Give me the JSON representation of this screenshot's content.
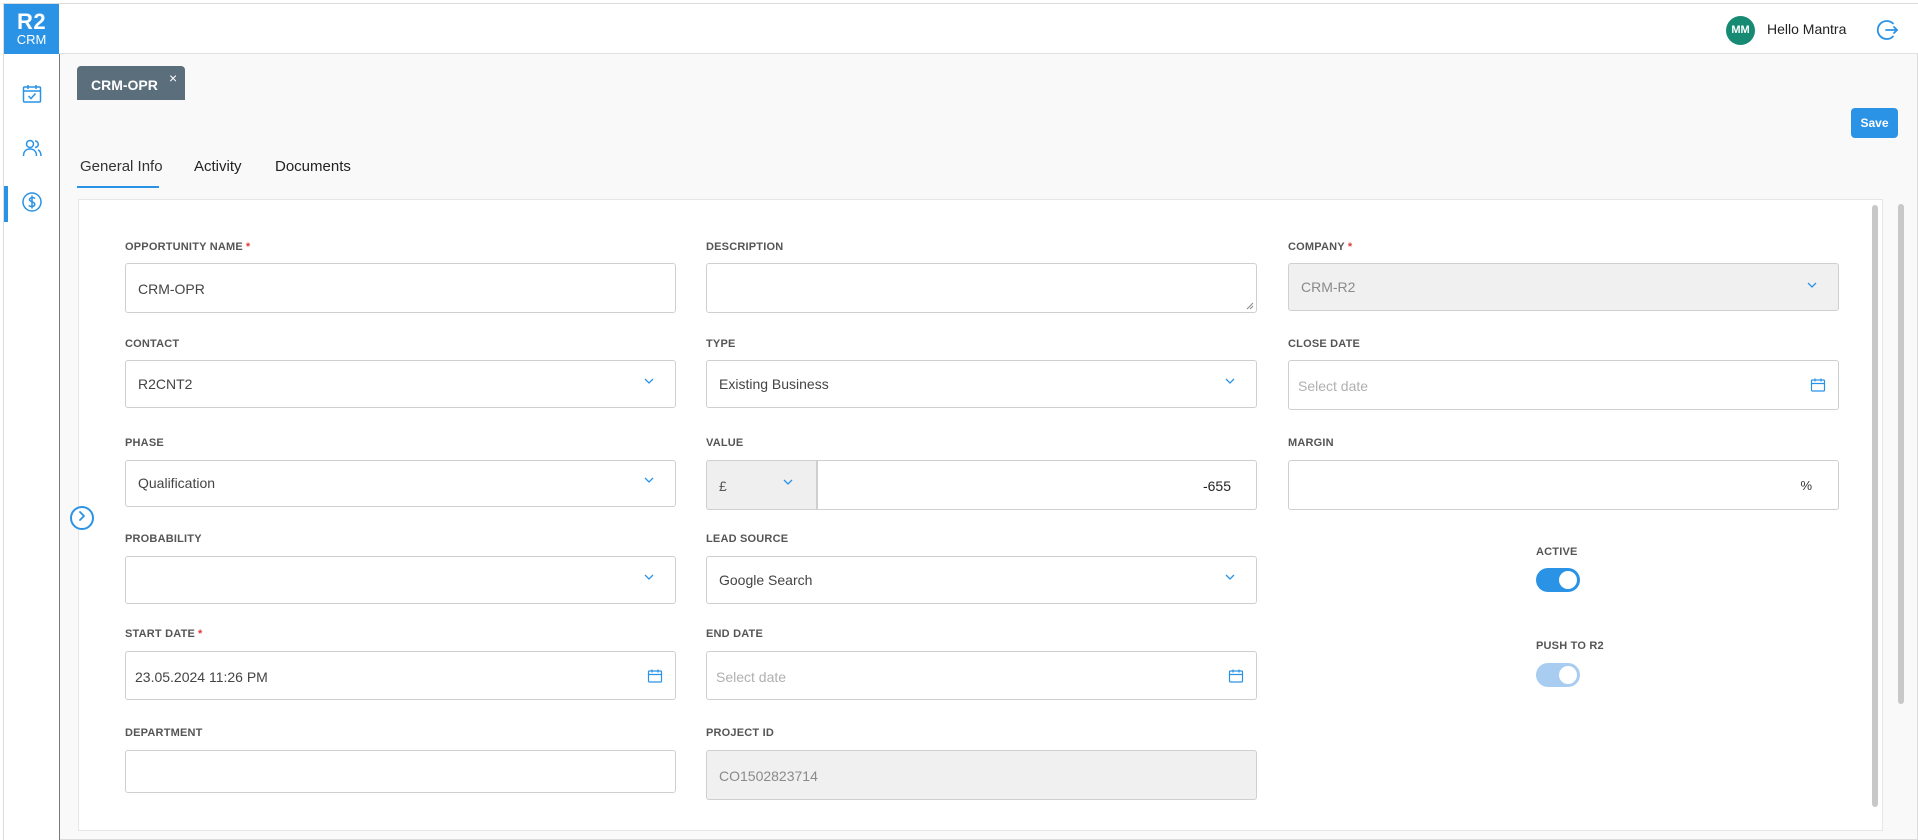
{
  "header": {
    "logo_top": "R2",
    "logo_bottom": "CRM",
    "avatar_initials": "MM",
    "greeting": "Hello Mantra"
  },
  "nav": {
    "items": [
      {
        "icon": "calendar-check-icon"
      },
      {
        "icon": "users-icon"
      },
      {
        "icon": "dollar-circle-icon",
        "active": true
      }
    ]
  },
  "record_tab": {
    "label": "CRM-OPR",
    "close": "×"
  },
  "toolbar": {
    "save_label": "Save"
  },
  "tabs": [
    {
      "label": "General Info",
      "active": true
    },
    {
      "label": "Activity"
    },
    {
      "label": "Documents"
    }
  ],
  "form": {
    "opportunity_name": {
      "label": "OPPORTUNITY NAME",
      "required": "*",
      "value": "CRM-OPR"
    },
    "description": {
      "label": "DESCRIPTION",
      "value": ""
    },
    "company": {
      "label": "COMPANY",
      "required": "*",
      "value": "CRM-R2"
    },
    "contact": {
      "label": "CONTACT",
      "value": "R2CNT2"
    },
    "type": {
      "label": "TYPE",
      "value": "Existing Business"
    },
    "close_date": {
      "label": "CLOSE DATE",
      "placeholder": "Select date"
    },
    "phase": {
      "label": "PHASE",
      "value": "Qualification"
    },
    "value": {
      "label": "VALUE",
      "currency": "£",
      "amount": "-655"
    },
    "margin": {
      "label": "MARGIN",
      "unit": "%"
    },
    "probability": {
      "label": "PROBABILITY",
      "value": ""
    },
    "lead_source": {
      "label": "LEAD SOURCE",
      "value": "Google Search"
    },
    "active": {
      "label": "ACTIVE",
      "on": true
    },
    "start_date": {
      "label": "START DATE",
      "required": "*",
      "value": "23.05.2024 11:26 PM"
    },
    "end_date": {
      "label": "END DATE",
      "placeholder": "Select date"
    },
    "push_to_r2": {
      "label": "PUSH TO R2",
      "on": true
    },
    "department": {
      "label": "DEPARTMENT",
      "value": ""
    },
    "project_id": {
      "label": "PROJECT ID",
      "value": "CO1502823714"
    }
  },
  "colors": {
    "accent": "#2a93e6",
    "tab_bg": "#5a6e7b",
    "avatar_bg": "#178a73",
    "required": "#e23b3b"
  }
}
